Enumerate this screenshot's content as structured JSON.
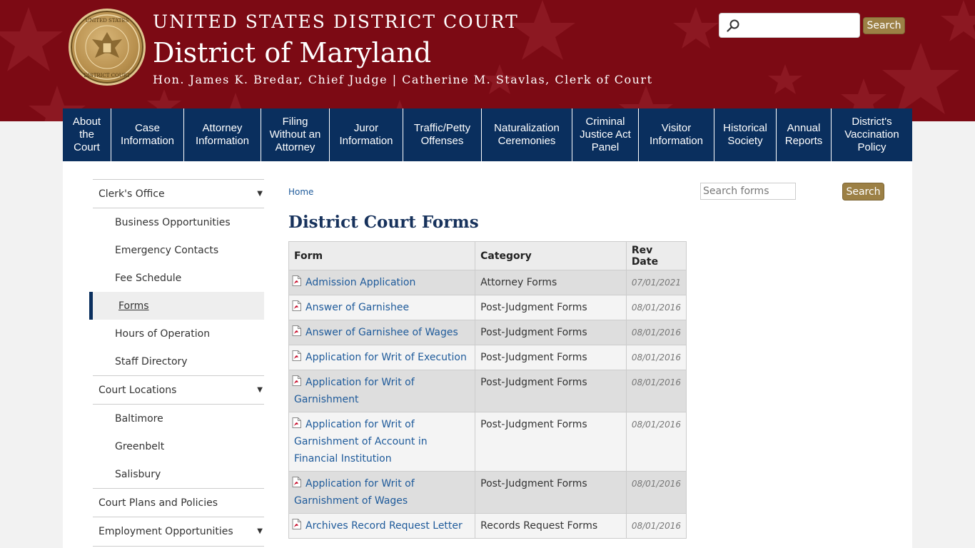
{
  "header": {
    "title_top": "UNITED STATES DISTRICT COURT",
    "title_main": "District of Maryland",
    "subtitle": "Hon. James K. Bredar, Chief Judge | Catherine M. Stavlas, Clerk of Court",
    "search_placeholder": "",
    "search_button": "Search",
    "seal_text_top": "UNITED STATES",
    "seal_text_bottom": "DISTRICT COURT"
  },
  "nav": [
    {
      "label": "About the Court",
      "lines": [
        "About",
        "the",
        "Court"
      ]
    },
    {
      "label": "Case Information",
      "lines": [
        "Case",
        "Information"
      ]
    },
    {
      "label": "Attorney Information",
      "lines": [
        "Attorney",
        "Information"
      ]
    },
    {
      "label": "Filing Without an Attorney",
      "lines": [
        "Filing",
        "Without an",
        "Attorney"
      ]
    },
    {
      "label": "Juror Information",
      "lines": [
        "Juror",
        "Information"
      ]
    },
    {
      "label": "Traffic/Petty Offenses",
      "lines": [
        "Traffic/Petty",
        "Offenses"
      ]
    },
    {
      "label": "Naturalization Ceremonies",
      "lines": [
        "Naturalization",
        "Ceremonies"
      ]
    },
    {
      "label": "Criminal Justice Act Panel",
      "lines": [
        "Criminal",
        "Justice Act",
        "Panel"
      ]
    },
    {
      "label": "Visitor Information",
      "lines": [
        "Visitor",
        "Information"
      ]
    },
    {
      "label": "Historical Society",
      "lines": [
        "Historical",
        "Society"
      ]
    },
    {
      "label": "Annual Reports",
      "lines": [
        "Annual",
        "Reports"
      ]
    },
    {
      "label": "District's Vaccination Policy",
      "lines": [
        "District's",
        "Vaccination",
        "Policy"
      ]
    }
  ],
  "sidebar": {
    "clerks_office": "Clerk's Office",
    "clerks_items": [
      "Business Opportunities",
      "Emergency Contacts",
      "Fee Schedule",
      "Forms",
      "Hours of Operation",
      "Staff Directory"
    ],
    "court_locations": "Court Locations",
    "location_items": [
      "Baltimore",
      "Greenbelt",
      "Salisbury"
    ],
    "court_plans": "Court Plans and Policies",
    "employment": "Employment Opportunities",
    "caret": "▼"
  },
  "main": {
    "breadcrumb": "Home",
    "search_placeholder": "Search forms",
    "search_button": "Search",
    "page_title": "District Court Forms",
    "columns": [
      "Form",
      "Category",
      "Rev Date"
    ],
    "rows": [
      {
        "form": "Admission Application",
        "category": "Attorney Forms",
        "rev": "07/01/2021"
      },
      {
        "form": "Answer of Garnishee",
        "category": "Post-Judgment Forms",
        "rev": "08/01/2016"
      },
      {
        "form": "Answer of Garnishee of Wages",
        "category": "Post-Judgment Forms",
        "rev": "08/01/2016"
      },
      {
        "form": "Application for Writ of Execution",
        "category": "Post-Judgment Forms",
        "rev": "08/01/2016"
      },
      {
        "form": "Application for Writ of Garnishment",
        "category": "Post-Judgment Forms",
        "rev": "08/01/2016"
      },
      {
        "form": "Application for Writ of Garnishment of Account in Financial Institution",
        "category": "Post-Judgment Forms",
        "rev": "08/01/2016"
      },
      {
        "form": "Application for Writ of Garnishment of Wages",
        "category": "Post-Judgment Forms",
        "rev": "08/01/2016"
      },
      {
        "form": "Archives Record Request Letter",
        "category": "Records Request Forms",
        "rev": "08/01/2016"
      }
    ]
  }
}
